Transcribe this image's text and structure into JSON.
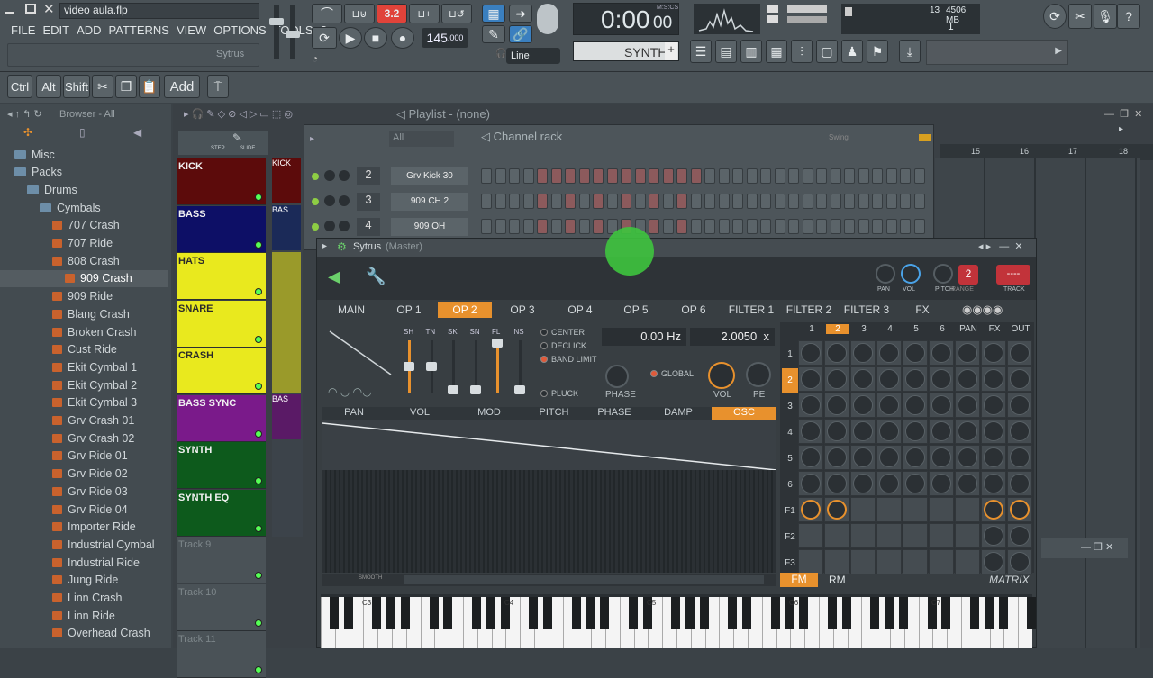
{
  "window": {
    "project": "video aula.flp"
  },
  "menu": [
    "FILE",
    "EDIT",
    "ADD",
    "PATTERNS",
    "VIEW",
    "OPTIONS",
    "TOOLS",
    "?"
  ],
  "hint": "Sytrus",
  "transport": {
    "pat_label": "3.2",
    "tempo": "145",
    "tempo_frac": ".000",
    "time": "0:00",
    "time_frac": "00",
    "time_unit": "M:S:CS",
    "snap": "Line",
    "channel": "SYNTH",
    "cpu": "13",
    "mem": "4506 MB",
    "poly": "1"
  },
  "toolbar2": [
    "Ctrl",
    "Alt",
    "Shift",
    "Add"
  ],
  "browser": {
    "title": "Browser - All",
    "items": [
      {
        "label": "Misc",
        "type": "folder",
        "indent": 0
      },
      {
        "label": "Packs",
        "type": "folder",
        "indent": 0
      },
      {
        "label": "Drums",
        "type": "folder",
        "indent": 1
      },
      {
        "label": "Cymbals",
        "type": "folder",
        "indent": 2
      },
      {
        "label": "707 Crash",
        "type": "file",
        "indent": 3
      },
      {
        "label": "707 Ride",
        "type": "file",
        "indent": 3
      },
      {
        "label": "808 Crash",
        "type": "file",
        "indent": 3
      },
      {
        "label": "909 Crash",
        "type": "file",
        "indent": 4,
        "selected": true
      },
      {
        "label": "909 Ride",
        "type": "file",
        "indent": 3
      },
      {
        "label": "Blang Crash",
        "type": "file",
        "indent": 3
      },
      {
        "label": "Broken Crash",
        "type": "file",
        "indent": 3
      },
      {
        "label": "Cust Ride",
        "type": "file",
        "indent": 3
      },
      {
        "label": "Ekit Cymbal 1",
        "type": "file",
        "indent": 3
      },
      {
        "label": "Ekit Cymbal 2",
        "type": "file",
        "indent": 3
      },
      {
        "label": "Ekit Cymbal 3",
        "type": "file",
        "indent": 3
      },
      {
        "label": "Grv Crash 01",
        "type": "file",
        "indent": 3
      },
      {
        "label": "Grv Crash 02",
        "type": "file",
        "indent": 3
      },
      {
        "label": "Grv Ride 01",
        "type": "file",
        "indent": 3
      },
      {
        "label": "Grv Ride 02",
        "type": "file",
        "indent": 3
      },
      {
        "label": "Grv Ride 03",
        "type": "file",
        "indent": 3
      },
      {
        "label": "Grv Ride 04",
        "type": "file",
        "indent": 3
      },
      {
        "label": "Importer Ride",
        "type": "file",
        "indent": 3
      },
      {
        "label": "Industrial Cymbal",
        "type": "file",
        "indent": 3
      },
      {
        "label": "Industrial Ride",
        "type": "file",
        "indent": 3
      },
      {
        "label": "Jung Ride",
        "type": "file",
        "indent": 3
      },
      {
        "label": "Linn Crash",
        "type": "file",
        "indent": 3
      },
      {
        "label": "Linn Ride",
        "type": "file",
        "indent": 3
      },
      {
        "label": "Overhead Crash",
        "type": "file",
        "indent": 3
      }
    ]
  },
  "playlist": {
    "title": "Playlist - (none)",
    "step": "STEP",
    "slide": "SLIDE",
    "bars": [
      "15",
      "16",
      "17",
      "18"
    ],
    "tracks": [
      {
        "name": "KICK",
        "color": "#5c0b0b"
      },
      {
        "name": "BASS",
        "color": "#0d0f66"
      },
      {
        "name": "HATS",
        "color": "#e9e91e"
      },
      {
        "name": "SNARE",
        "color": "#e9e91e"
      },
      {
        "name": "CRASH",
        "color": "#e9e91e"
      },
      {
        "name": "BASS SYNC",
        "color": "#7a1a8a"
      },
      {
        "name": "SYNTH",
        "color": "#0d5a1c"
      },
      {
        "name": "SYNTH EQ",
        "color": "#0d5a1c"
      },
      {
        "name": "Track 9",
        "color": "#4a5257"
      },
      {
        "name": "Track 10",
        "color": "#4a5257"
      },
      {
        "name": "Track 11",
        "color": "#4a5257"
      }
    ],
    "clips": [
      "KICK",
      "BAS",
      "",
      "",
      "",
      "BAS"
    ]
  },
  "rack": {
    "title": "Channel rack",
    "filter": "All",
    "swing": "Swing",
    "channels": [
      {
        "num": "2",
        "name": "Grv Kick 30"
      },
      {
        "num": "3",
        "name": "909 CH 2"
      },
      {
        "num": "4",
        "name": "909 OH"
      }
    ]
  },
  "sytrus": {
    "title": "Sytrus",
    "subtitle": "(Master)",
    "top_knobs": [
      "PAN",
      "VOL",
      "PITCH",
      "RANGE",
      "TRACK"
    ],
    "range_value": "2",
    "track_value": "----",
    "tabs": [
      "MAIN",
      "OP 1",
      "OP 2",
      "OP 3",
      "OP 4",
      "OP 5",
      "OP 6",
      "FILTER 1",
      "FILTER 2",
      "FILTER 3",
      "FX"
    ],
    "sliders": [
      "SH",
      "TN",
      "SK",
      "SN",
      "FL",
      "NS"
    ],
    "options": [
      "CENTER",
      "DECLICK",
      "BAND LIMIT",
      "PLUCK",
      "GLOBAL"
    ],
    "freq": "0.00 Hz",
    "ratio": "2.0050",
    "ratio_x": "x",
    "knobs": [
      "PHASE",
      "VOL",
      "PE"
    ],
    "subtabs": [
      "PAN",
      "VOL",
      "MOD",
      "PITCH",
      "PHASE",
      "DAMP",
      "OSC"
    ],
    "smooth": "SMOOTH",
    "matrix_cols": [
      "1",
      "2",
      "3",
      "4",
      "5",
      "6",
      "PAN",
      "FX",
      "OUT"
    ],
    "matrix_rows": [
      "1",
      "2",
      "3",
      "4",
      "5",
      "6",
      "F1",
      "F2",
      "F3"
    ],
    "fm": "FM",
    "rm": "RM",
    "matrix": "MATRIX",
    "keys": [
      "C3",
      "C4",
      "C5",
      "C6",
      "C7"
    ]
  }
}
